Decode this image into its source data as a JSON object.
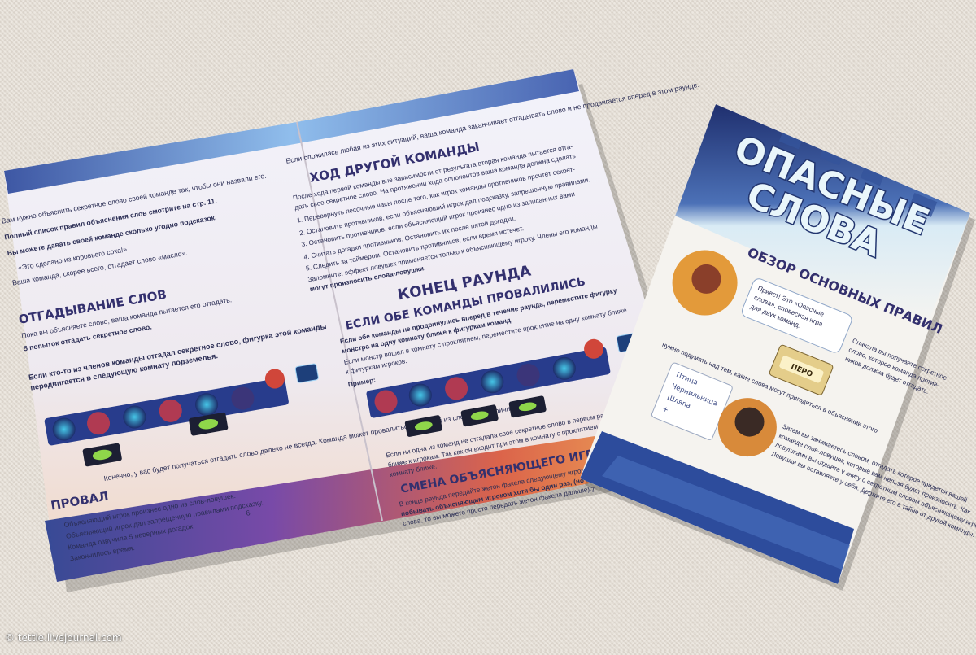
{
  "watermark": "© tettie.livejournal.com",
  "booklet": {
    "left_page": {
      "intro_lines": [
        "Вам нужно объяснить секретное слово своей команде так, чтобы они назвали его.",
        "Полный список правил объяснения слов смотрите на стр. 11.",
        "Вы можете давать своей команде сколько угодно подсказок.",
        "«Это сделано из коровьего сока!»",
        "Ваша команда, скорее всего, отгадает слово «масло»."
      ],
      "heading_guess": "ОТГАДЫВАНИЕ СЛОВ",
      "guess_lines": [
        "Пока вы объясняете слово, ваша команда пытается его отгадать.",
        "5 попыток отгадать секретное слово.",
        "Если кто-то из членов команды отгадал секретное слово, фигурка этой команды",
        "передвигается в следующую комнату подземелья."
      ],
      "heading_fail": "ПРОВАЛ",
      "fail_intro": "Конечно, у вас будет получаться отгадать слово далеко не всегда. Команда может провалиться по одной из следующих причин:",
      "fail_items": [
        "Объясняющий игрок произнес одно из слов-ловушек.",
        "Объясняющий игрок дал запрещенную правилами подсказку.",
        "Команда озвучила 5 неверных догадок.",
        "Закончилось время."
      ],
      "page_number": "6"
    },
    "right_page": {
      "top_line": "Если сложилась любая из этих ситуаций, ваша команда заканчивает отгадывать слово и не продвигается вперед в этом раунде.",
      "heading_other_turn": "ХОД ДРУГОЙ КОМАНДЫ",
      "other_turn_lines": [
        "После хода первой команды вне зависимости от результата вторая команда пытается отга-",
        "дать свое секретное слово. На протяжении хода оппонентов ваша команда должна сделать",
        "1. Перевернуть песочные часы после того, как игрок команды противников прочтет секрет-",
        "2. Остановить противников, если объясняющий игрок дал подсказку, запрещенную правилами.",
        "3. Остановить противников, если объясняющий игрок произнес одно из записанных вами",
        "4. Считать догадки противников. Остановить их после пятой догадки.",
        "5. Следить за таймером. Остановить противников, если время истечет.",
        "Запомните: эффект ловушек применяется только к объясняющему игроку. Члены его команды",
        "могут произносить слова-ловушки."
      ],
      "heading_end_round": "КОНЕЦ РАУНДА",
      "heading_both_failed": "ЕСЛИ ОБЕ КОМАНДЫ ПРОВАЛИЛИСЬ",
      "both_failed_lines": [
        "Если обе команды не продвинулись вперед в течение раунда, переместите фигурку",
        "монстра на одну комнату ближе к фигуркам команд.",
        "Если монстр вошел в комнату с проклятием, переместите проклятие на одну комнату ближе",
        "к фигуркам игроков."
      ],
      "example_label": "Пример:",
      "example_lines": [
        "Если ни одна из команд не отгадала свое секретное слово в первом раунде, монстр перемещается",
        "ближе к игрокам. Так как он входит при этом в комнату с проклятием, оно тоже сдвигается на одну",
        "комнату ближе."
      ],
      "heading_change": "СМЕНА ОБЪЯСНЯЮЩЕГО ИГРОКА",
      "change_lines": [
        "В конце раунда передайте жетон факела следующему игроку. Каждый член команды должен",
        "побывать объясняющим игроком хотя бы один раз, (но если кто-то не хочет объяснять",
        "слова, то вы можете просто передать жетон факела дальше)."
      ],
      "page_number": "7"
    }
  },
  "card": {
    "logo_line1": "ОПАСНЫЕ",
    "logo_line2": "СЛОВА",
    "overview_title": "ОБЗОР ОСНОВНЫХ ПРАВИЛ",
    "speech_bubble": [
      "Привет! Это «Опасные",
      "слова», словесная игра",
      "для двух команд."
    ],
    "secret_text": [
      "Сначала вы получаете секретное",
      "слово, которое команда против-",
      "ников должна будет отгадать."
    ],
    "word_card": "ПЕРО",
    "think_text": "нужно подумать над тем, какие слова могут пригодиться в объяснении этого",
    "notepad_items": [
      "Птица",
      "Чернильница",
      "Шляпа",
      "+"
    ],
    "bottom_lines": [
      "Затем вы занимаетесь словом, отгадать которое придется вашей",
      "команде слов-ловушек, которые вам нельзя будет произносить. Как",
      "ловушками вы отдаете у книгу с секретным словом объясняющему игроку",
      "Ловушки вы оставляете у себя. Держите его в тайне от другой команды."
    ]
  }
}
